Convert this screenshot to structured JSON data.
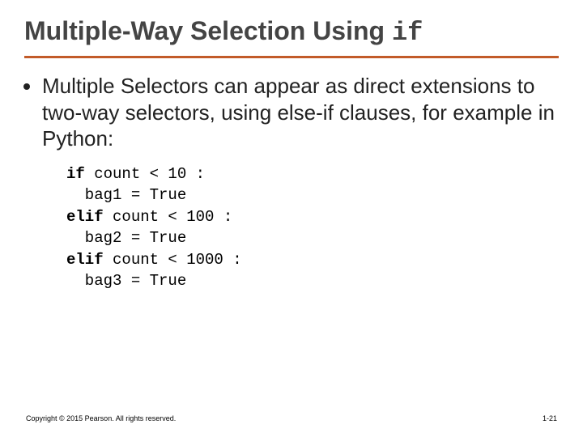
{
  "title": {
    "text": "Multiple-Way Selection Using ",
    "mono": "if"
  },
  "bullet": "Multiple Selectors can appear as direct extensions to two-way selectors, using else-if clauses, for example in Python:",
  "code": {
    "l1a": "if",
    "l1b": " count < 10 :",
    "l2": "  bag1 = True",
    "l3a": "elif",
    "l3b": " count < 100 :",
    "l4": "  bag2 = True",
    "l5a": "elif",
    "l5b": " count < 1000 :",
    "l6": "  bag3 = True"
  },
  "footer": "Copyright © 2015 Pearson. All rights reserved.",
  "pagenum": "1-21"
}
